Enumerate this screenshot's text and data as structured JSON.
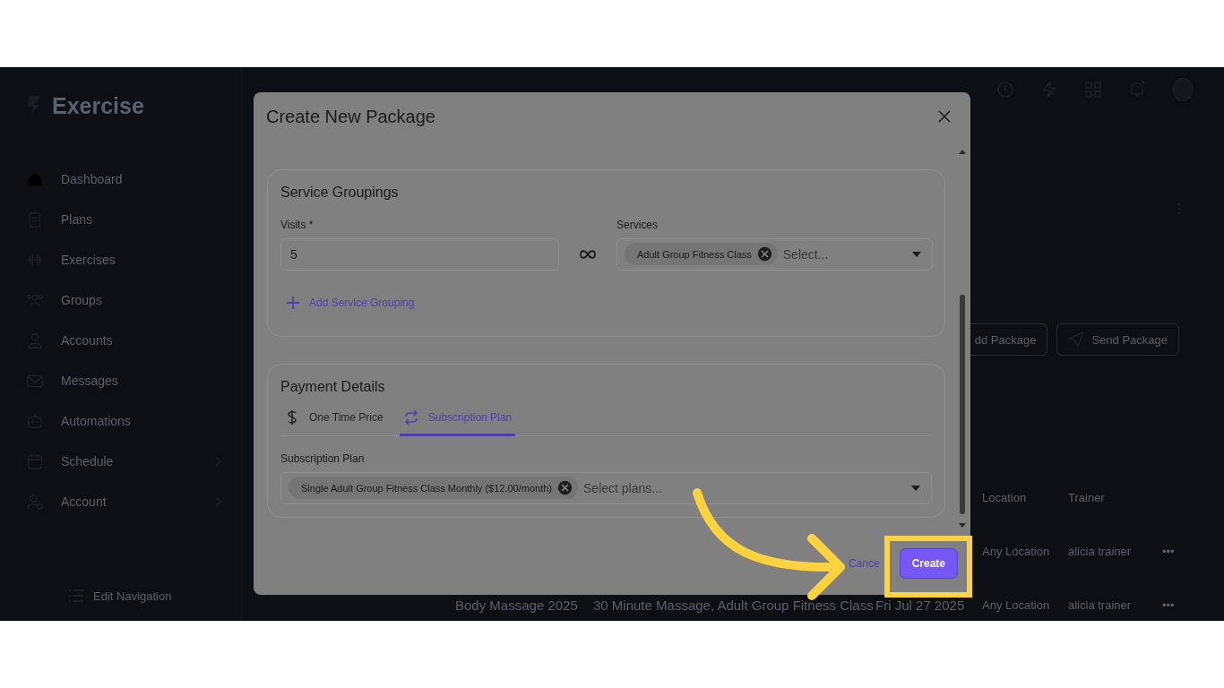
{
  "app": {
    "logo": "Exercise",
    "sidebar": [
      {
        "label": "Dashboard",
        "expandable": false
      },
      {
        "label": "Plans",
        "expandable": false
      },
      {
        "label": "Exercises",
        "expandable": false
      },
      {
        "label": "Groups",
        "expandable": false
      },
      {
        "label": "Accounts",
        "expandable": false
      },
      {
        "label": "Messages",
        "expandable": false
      },
      {
        "label": "Automations",
        "expandable": false
      },
      {
        "label": "Schedule",
        "expandable": true
      },
      {
        "label": "Account",
        "expandable": true
      }
    ],
    "edit_navigation": "Edit Navigation",
    "actions": [
      "dd Package",
      "Send Package"
    ],
    "table": {
      "columns": [
        "Location",
        "Trainer"
      ],
      "rows": [
        {
          "location": "Any Location",
          "trainer": "alicia trainer",
          "menu": "•••"
        },
        {
          "name": "Body Massage 2025",
          "services": "30 Minute Massage, Adult Group Fitness Class",
          "date": "Fri Jul 27 2025",
          "location": "Any Location",
          "trainer": "alicia trainer",
          "menu": "•••"
        }
      ]
    }
  },
  "modal": {
    "title": "Create New Package",
    "service_groupings": {
      "title": "Service Groupings",
      "visits_label": "Visits *",
      "visits_value": "5",
      "services_label": "Services",
      "services_chips": [
        "Adult Group Fitness Class"
      ],
      "services_placeholder": "Select...",
      "add_link": "Add Service Grouping"
    },
    "payment_details": {
      "title": "Payment Details",
      "tabs": [
        {
          "label": "One Time Price",
          "selected": false
        },
        {
          "label": "Subscription Plan",
          "selected": true
        }
      ],
      "plan_label": "Subscription Plan",
      "plan_chips": [
        "Single Adult Group Fitness Class Monthly ($12.00/month)"
      ],
      "plan_placeholder": "Select plans..."
    },
    "buttons": {
      "cancel": "Cance",
      "create": "Create"
    }
  }
}
